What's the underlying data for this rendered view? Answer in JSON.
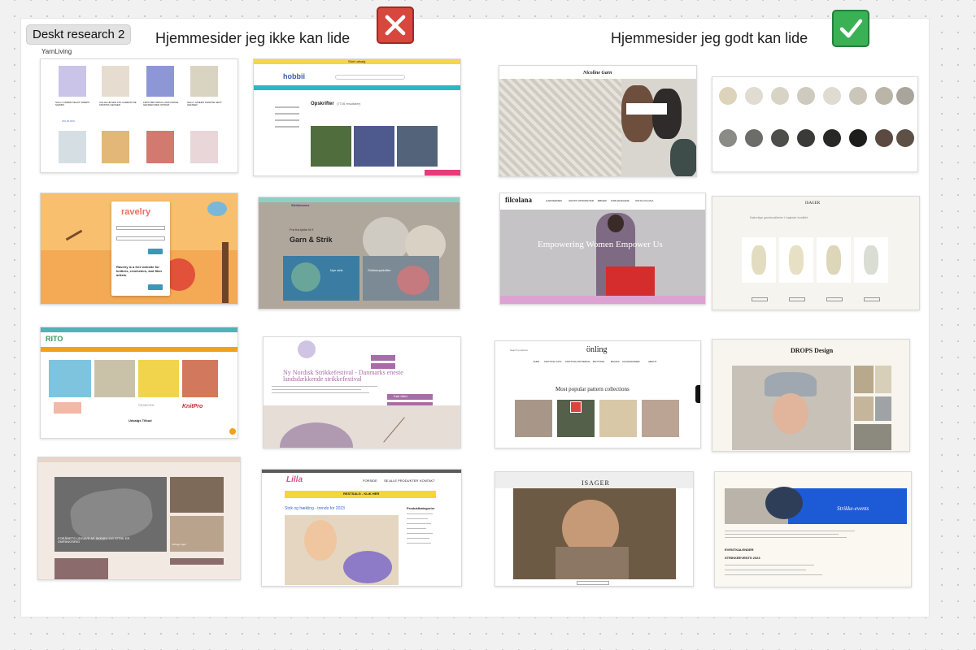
{
  "board": {
    "title": "Deskt research 2",
    "subtitle": "YarnLiving",
    "heading_dislike": "Hjemmesider jeg ikke kan lide",
    "heading_like": "Hjemmesider jeg godt kan lide",
    "dislike_icon": "cross-mark-icon",
    "like_icon": "check-mark-icon"
  },
  "colors": {
    "dislike": "#d7473e",
    "like": "#3bb156"
  },
  "thumbs": {
    "yarnliving": {
      "products": [
        "SALLY ANDER FELDT SWEPS SHIMIKI",
        "CALLE HILSEN FIN CAMEON SE KROPSS GENSER",
        "LEDO BETURIKA LAND PAKKE GENSER MED OPSKRI",
        "SALLY SWEEN SHORTE SEXT GENSER"
      ],
      "price": "150,00 DKK"
    },
    "hobbii": {
      "logo": "hobbii",
      "heading": "Opskrifter",
      "count": "(7726 resultater)",
      "banner": "Stort udsalg"
    },
    "ravelry": {
      "logo": "ravelry",
      "text": "Ravelry is a free website for knitters, crocheters, and fiber artists.",
      "login": "Log in"
    },
    "strikkeanes": {
      "logo": "Strikkeanes",
      "kicker": "Fra frø.lykke til fi",
      "title": "Garn & Strik",
      "card1": "Nye strik",
      "card2": "Strikkeopskrifter"
    },
    "rito": {
      "logo": "RITO",
      "brand": "KnitPro",
      "sale": "Udsalgs Tilbud"
    },
    "festival": {
      "title": "Ny Nordisk Strikkefestival - Danmarks eneste landsdækkende strikkefestival",
      "button": "Køb billet"
    },
    "shawl": {
      "caption": "FORÅRETS UDGAVE AF SKRÆV OG STRIK ER OMFANGSRIG",
      "caption2": "Vintage trøjer"
    },
    "lilla": {
      "logo": "Lilla",
      "nav": [
        "FORSIDE",
        "SE ALLE PRODUKTER",
        "KONTAKT"
      ],
      "banner": "RESTSALG - KLIK HER",
      "headline": "Strik og hækling - trends for 2023",
      "sidebar_title": "Produktkategorier"
    },
    "nicoline": {
      "title": "Nicoline Garn"
    },
    "filcolana": {
      "logo": "filcolana",
      "hero": "Empowering Women Empower Us",
      "nav": [
        "GARNSERIER",
        "GRATIS OPSKRIFTER",
        "BØGER",
        "FORHANDLERE",
        "OM FILCOLANA"
      ]
    },
    "isager": {
      "logo": "ISAGER"
    },
    "onling": {
      "logo": "önling",
      "heading": "Most popular pattern collections",
      "nav": [
        "YARN",
        "KNITTING KITS",
        "KNITTING PATTERNS",
        "BUTTONS",
        "BOOKS",
        "ACCESSORIES",
        "ABOUT"
      ]
    },
    "drops": {
      "logo": "DROPS Design"
    },
    "studio": {
      "hero": "Strikke-events",
      "heading": "EVENTKALENDER",
      "sub": "STRIKKEEVENTS 2023"
    },
    "knitshop": {
      "logo": "ISAGER",
      "line": "Naturlige garnkvaliteter i højeste kvalitet"
    }
  }
}
